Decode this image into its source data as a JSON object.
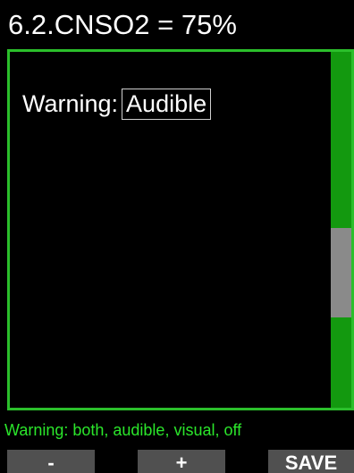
{
  "header": {
    "title": "6.2.CNSO2 = 75%"
  },
  "setting": {
    "label": "Warning:",
    "value": "Audible"
  },
  "scrollbar": {
    "thumb_position_fraction": 0.5
  },
  "hint": {
    "text": "Warning: both, audible, visual, off"
  },
  "softkeys": {
    "minus_label": "-",
    "plus_label": "+",
    "save_label": "SAVE"
  },
  "colors": {
    "background": "#000000",
    "accent_green": "#2bbf2b",
    "hint_green": "#2be62b",
    "softkey_gray": "#505050",
    "scroll_thumb": "#8a8a8a"
  }
}
